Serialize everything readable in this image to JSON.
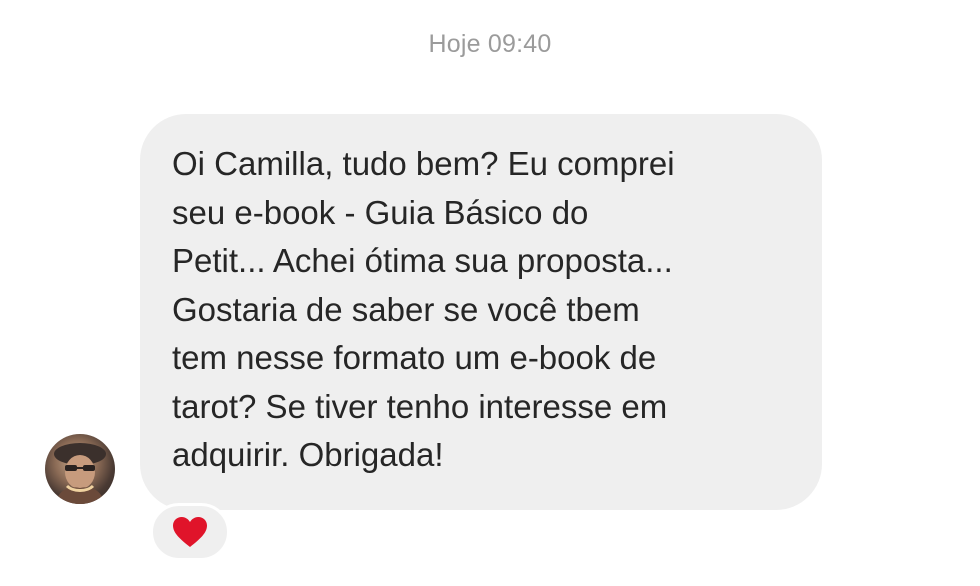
{
  "chat": {
    "timestamp": "Hoje 09:40",
    "message": {
      "text": "Oi Camilla, tudo bem? Eu comprei\nseu e-book - Guia Básico do\nPetit... Achei ótima sua proposta...\nGostaria de saber se você tbem\ntem nesse formato um e-book de\ntarot? Se tiver tenho interesse em\nadquirir. Obrigada!",
      "reaction_icon": "heart-icon",
      "reaction_color": "#e0142a"
    },
    "sender_avatar_icon": "avatar"
  },
  "colors": {
    "bubble_background": "#efefef",
    "timestamp_text": "#9b9b9b",
    "message_text": "#262626"
  }
}
